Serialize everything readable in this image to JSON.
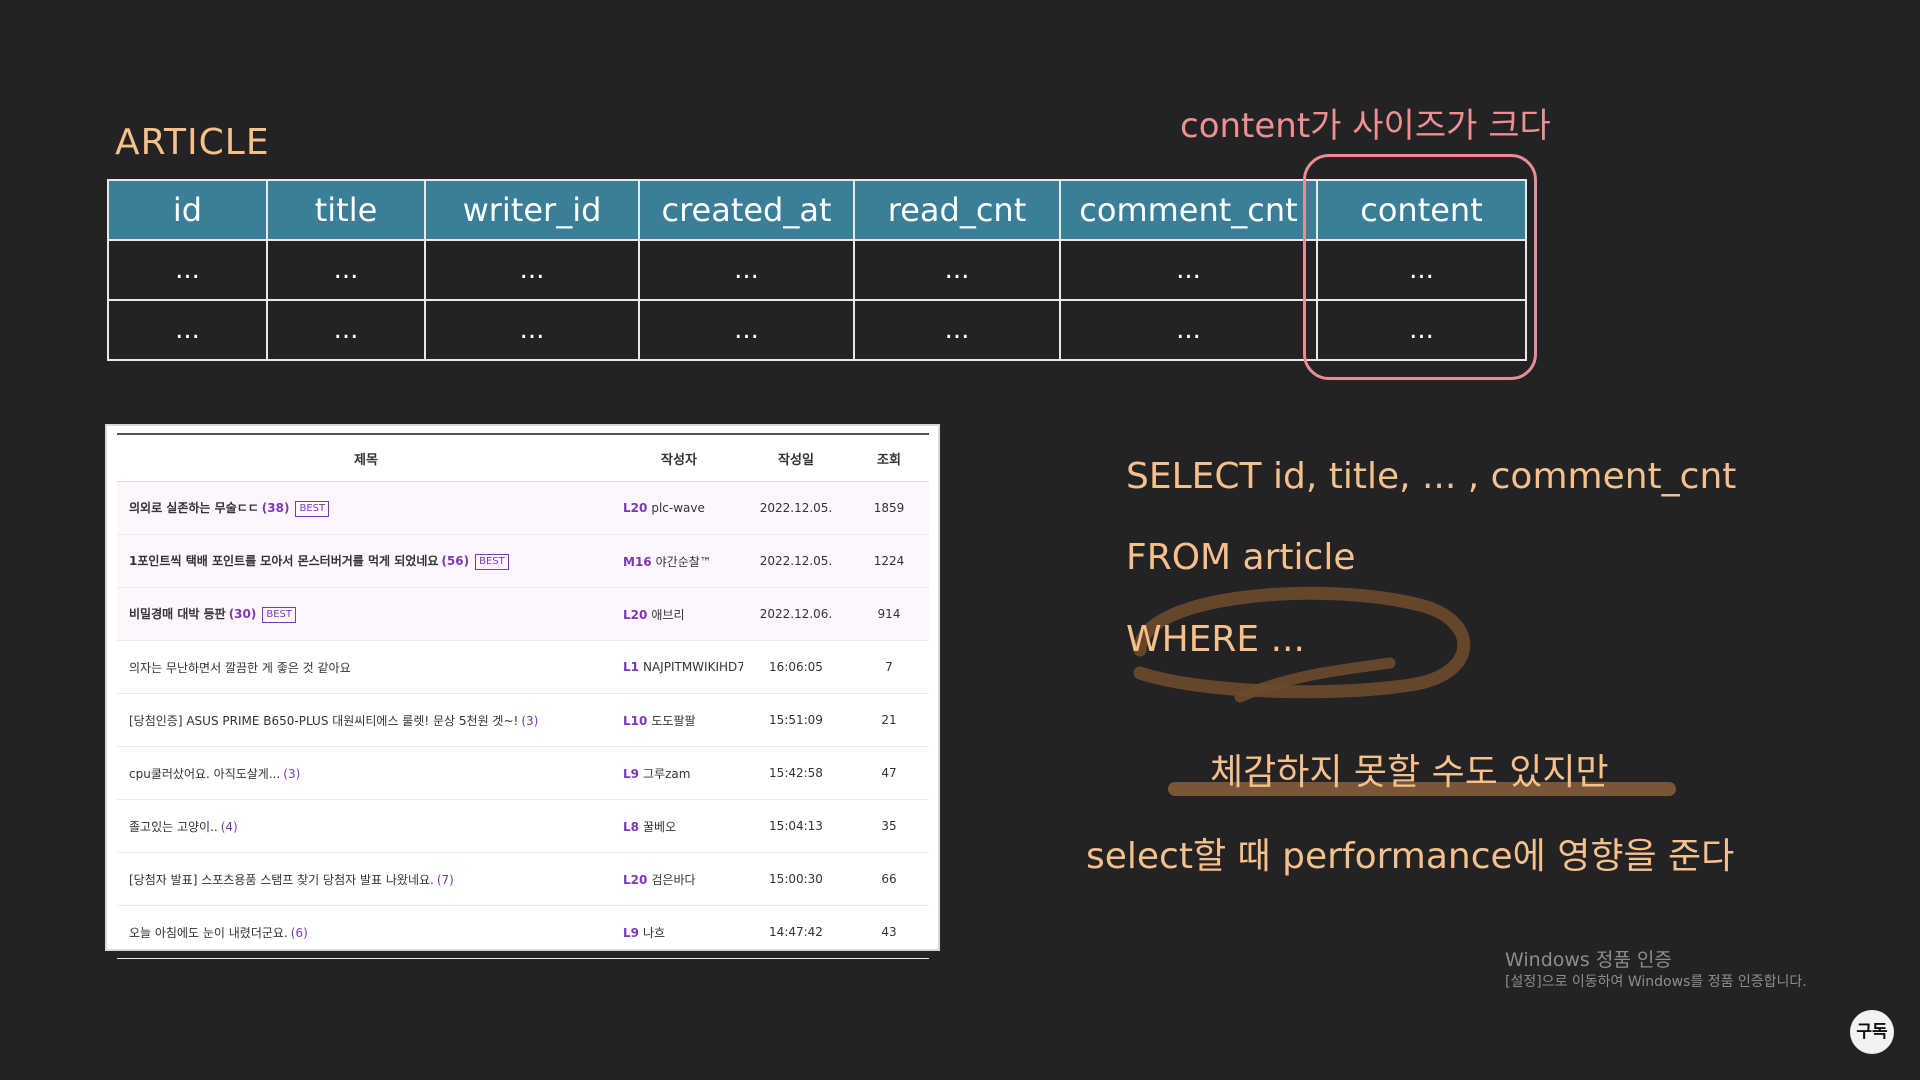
{
  "schema": {
    "title": "ARTICLE",
    "columns": [
      "id",
      "title",
      "writer_id",
      "created_at",
      "read_cnt",
      "comment_cnt",
      "content"
    ],
    "rows": [
      [
        "...",
        "...",
        "...",
        "...",
        "...",
        "...",
        "..."
      ],
      [
        "...",
        "...",
        "...",
        "...",
        "...",
        "...",
        "..."
      ]
    ],
    "content_note": "content가 사이즈가 크다"
  },
  "board": {
    "headers": {
      "title": "제목",
      "writer": "작성자",
      "date": "작성일",
      "views": "조회"
    },
    "best_label": "BEST",
    "rows": [
      {
        "title": "의외로 실존하는 무술ㄷㄷ",
        "comments": "(38)",
        "best": true,
        "level": "L20",
        "writer": "plc-wave",
        "date": "2022.12.05.",
        "views": "1859"
      },
      {
        "title": "1포인트씩 택배 포인트를 모아서 몬스터버거를 먹게 되었네요",
        "comments": "(56)",
        "best": true,
        "level": "M16",
        "writer": "야간순찰™",
        "date": "2022.12.05.",
        "views": "1224"
      },
      {
        "title": "비밀경매 대박 등판",
        "comments": "(30)",
        "best": true,
        "level": "L20",
        "writer": "애브리",
        "date": "2022.12.06.",
        "views": "914"
      },
      {
        "title": "의자는 무난하면서 깔끔한 게 좋은 것 같아요",
        "comments": "",
        "best": false,
        "level": "L1",
        "writer": "NAJPITMWIKIHD7",
        "date": "16:06:05",
        "views": "7"
      },
      {
        "title": "[당첨인증] ASUS PRIME B650-PLUS 대원씨티에스 룰렛! 문상 5천원 겟~!",
        "comments": "(3)",
        "best": false,
        "level": "L10",
        "writer": "도도팔팔",
        "date": "15:51:09",
        "views": "21"
      },
      {
        "title": "cpu쿨러샀어요. 아직도살게...",
        "comments": "(3)",
        "best": false,
        "level": "L9",
        "writer": "그루zam",
        "date": "15:42:58",
        "views": "47"
      },
      {
        "title": "졸고있는 고양이..",
        "comments": "(4)",
        "best": false,
        "level": "L8",
        "writer": "꿀베오",
        "date": "15:04:13",
        "views": "35"
      },
      {
        "title": "[당첨자 발표] 스포츠용품 스탬프 찾기 당첨자 발표 나왔네요.",
        "comments": "(7)",
        "best": false,
        "level": "L20",
        "writer": "검은바다",
        "date": "15:00:30",
        "views": "66"
      },
      {
        "title": "오늘 아침에도 눈이 내렸더군요.",
        "comments": "(6)",
        "best": false,
        "level": "L9",
        "writer": "나흐",
        "date": "14:47:42",
        "views": "43"
      }
    ]
  },
  "sql": {
    "select": "SELECT id, title, ... , comment_cnt",
    "from": "FROM article",
    "where": "WHERE ..."
  },
  "notes": {
    "feel": "체감하지 못할 수도 있지만",
    "perf": "select할 때 performance에 영향을 준다"
  },
  "windows": {
    "title": "Windows 정품 인증",
    "subtitle": "[설정]으로 이동하여 Windows를 정품 인증합니다."
  },
  "subscribe": "구독",
  "colors": {
    "background": "#232225",
    "header_teal": "#3a7f97",
    "accent_orange": "#f5c08a",
    "highlight_pink": "#e98d95",
    "level_purple": "#7b39b5"
  }
}
